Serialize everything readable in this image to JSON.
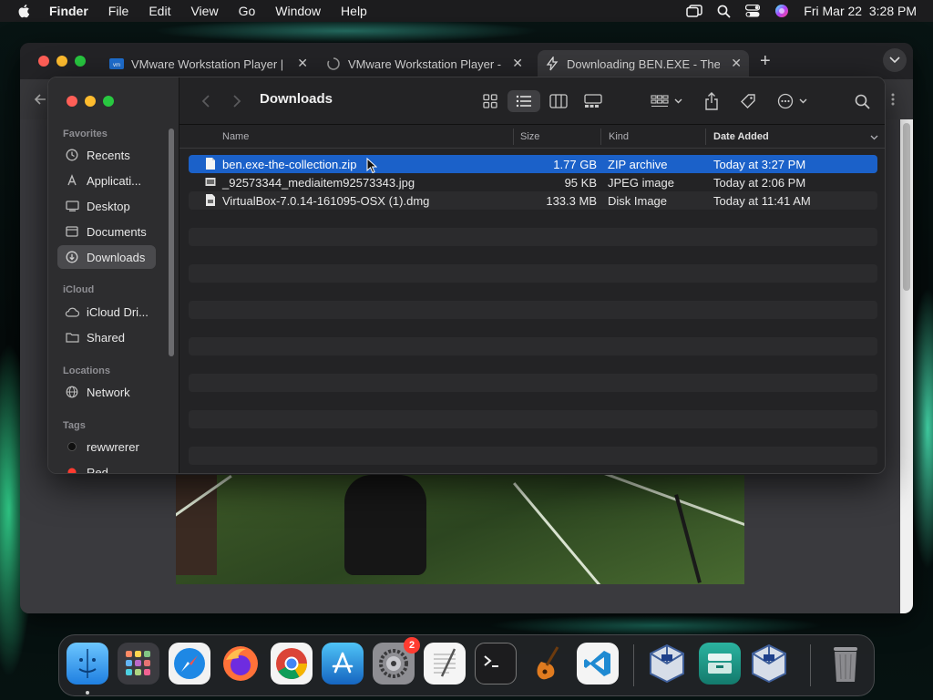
{
  "menubar": {
    "app_name": "Finder",
    "items": [
      "File",
      "Edit",
      "View",
      "Go",
      "Window",
      "Help"
    ],
    "datetime": "Fri Mar 22  3:28 PM"
  },
  "browser": {
    "tabs": [
      {
        "label": "VMware Workstation Player |"
      },
      {
        "label": "VMware Workstation Player -"
      },
      {
        "label": "Downloading BEN.EXE - The"
      }
    ],
    "new_tab": "+"
  },
  "finder": {
    "title": "Downloads",
    "sidebar": {
      "favorites_header": "Favorites",
      "favorites": [
        {
          "label": "Recents",
          "icon": "clock-icon"
        },
        {
          "label": "Applicati...",
          "icon": "applications-icon"
        },
        {
          "label": "Desktop",
          "icon": "desktop-icon"
        },
        {
          "label": "Documents",
          "icon": "document-icon"
        },
        {
          "label": "Downloads",
          "icon": "download-icon",
          "selected": true
        }
      ],
      "icloud_header": "iCloud",
      "icloud": [
        {
          "label": "iCloud Dri...",
          "icon": "cloud-icon"
        },
        {
          "label": "Shared",
          "icon": "shared-folder-icon"
        }
      ],
      "locations_header": "Locations",
      "locations": [
        {
          "label": "Network",
          "icon": "globe-icon"
        }
      ],
      "tags_header": "Tags",
      "tags": [
        {
          "label": "rewwrerer",
          "color": "#1c1c1c"
        },
        {
          "label": "Red",
          "color": "#ff3b30"
        }
      ]
    },
    "columns": {
      "name": "Name",
      "size": "Size",
      "kind": "Kind",
      "date_added": "Date Added"
    },
    "files": [
      {
        "name": "ben.exe-the-collection.zip",
        "size": "1.77 GB",
        "kind": "ZIP archive",
        "date_added": "Today at 3:27 PM",
        "selected": true
      },
      {
        "name": "_92573344_mediaitem92573343.jpg",
        "size": "95 KB",
        "kind": "JPEG image",
        "date_added": "Today at 2:06 PM"
      },
      {
        "name": "VirtualBox-7.0.14-161095-OSX (1).dmg",
        "size": "133.3 MB",
        "kind": "Disk Image",
        "date_added": "Today at 11:41 AM"
      }
    ]
  },
  "dock": {
    "settings_badge": "2",
    "apps": [
      "finder-icon",
      "launchpad-icon",
      "safari-icon",
      "firefox-icon",
      "chrome-icon",
      "app-store-icon",
      "system-settings-icon",
      "textedit-icon",
      "terminal-icon",
      "garageband-icon",
      "vscode-icon",
      "virtualbox-icon",
      "archive-utility-icon",
      "virtualbox-icon",
      "trash-icon"
    ]
  },
  "colors": {
    "selection": "#1b61c9",
    "finder_bg": "#232325",
    "sidebar_bg": "#2d2d2f"
  }
}
